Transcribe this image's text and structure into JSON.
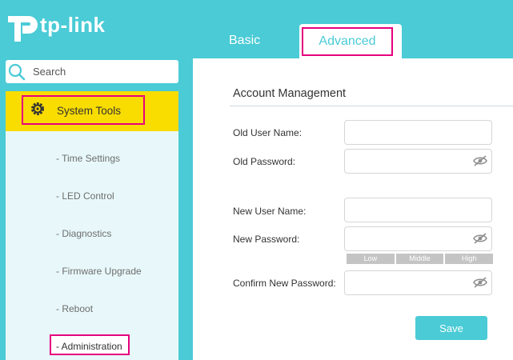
{
  "brand": {
    "name": "tp-link"
  },
  "tabs": [
    {
      "label": "Basic"
    },
    {
      "label": "Advanced"
    }
  ],
  "search": {
    "placeholder": "Search"
  },
  "sidebar": {
    "section": "System Tools",
    "items": [
      {
        "label": "- Time Settings"
      },
      {
        "label": "- LED Control"
      },
      {
        "label": "- Diagnostics"
      },
      {
        "label": "- Firmware Upgrade"
      },
      {
        "label": "- Reboot"
      },
      {
        "label": "- Administration"
      }
    ]
  },
  "account": {
    "title": "Account Management",
    "old_user_label": "Old User Name:",
    "old_pass_label": "Old Password:",
    "new_user_label": "New User Name:",
    "new_pass_label": "New Password:",
    "confirm_pass_label": "Confirm New Password:",
    "old_user_value": "",
    "old_pass_value": "",
    "new_user_value": "",
    "new_pass_value": "",
    "confirm_pass_value": "",
    "strength": [
      "Low",
      "Middle",
      "High"
    ],
    "save_label": "Save"
  },
  "colors": {
    "accent": "#4acbd6",
    "highlight": "#e6007e",
    "section_active": "#f9dc00"
  },
  "icons": {
    "logo": "tp-link-logo-icon",
    "search": "search-icon",
    "section": "gear-icon",
    "password": "eye-slash-icon"
  }
}
